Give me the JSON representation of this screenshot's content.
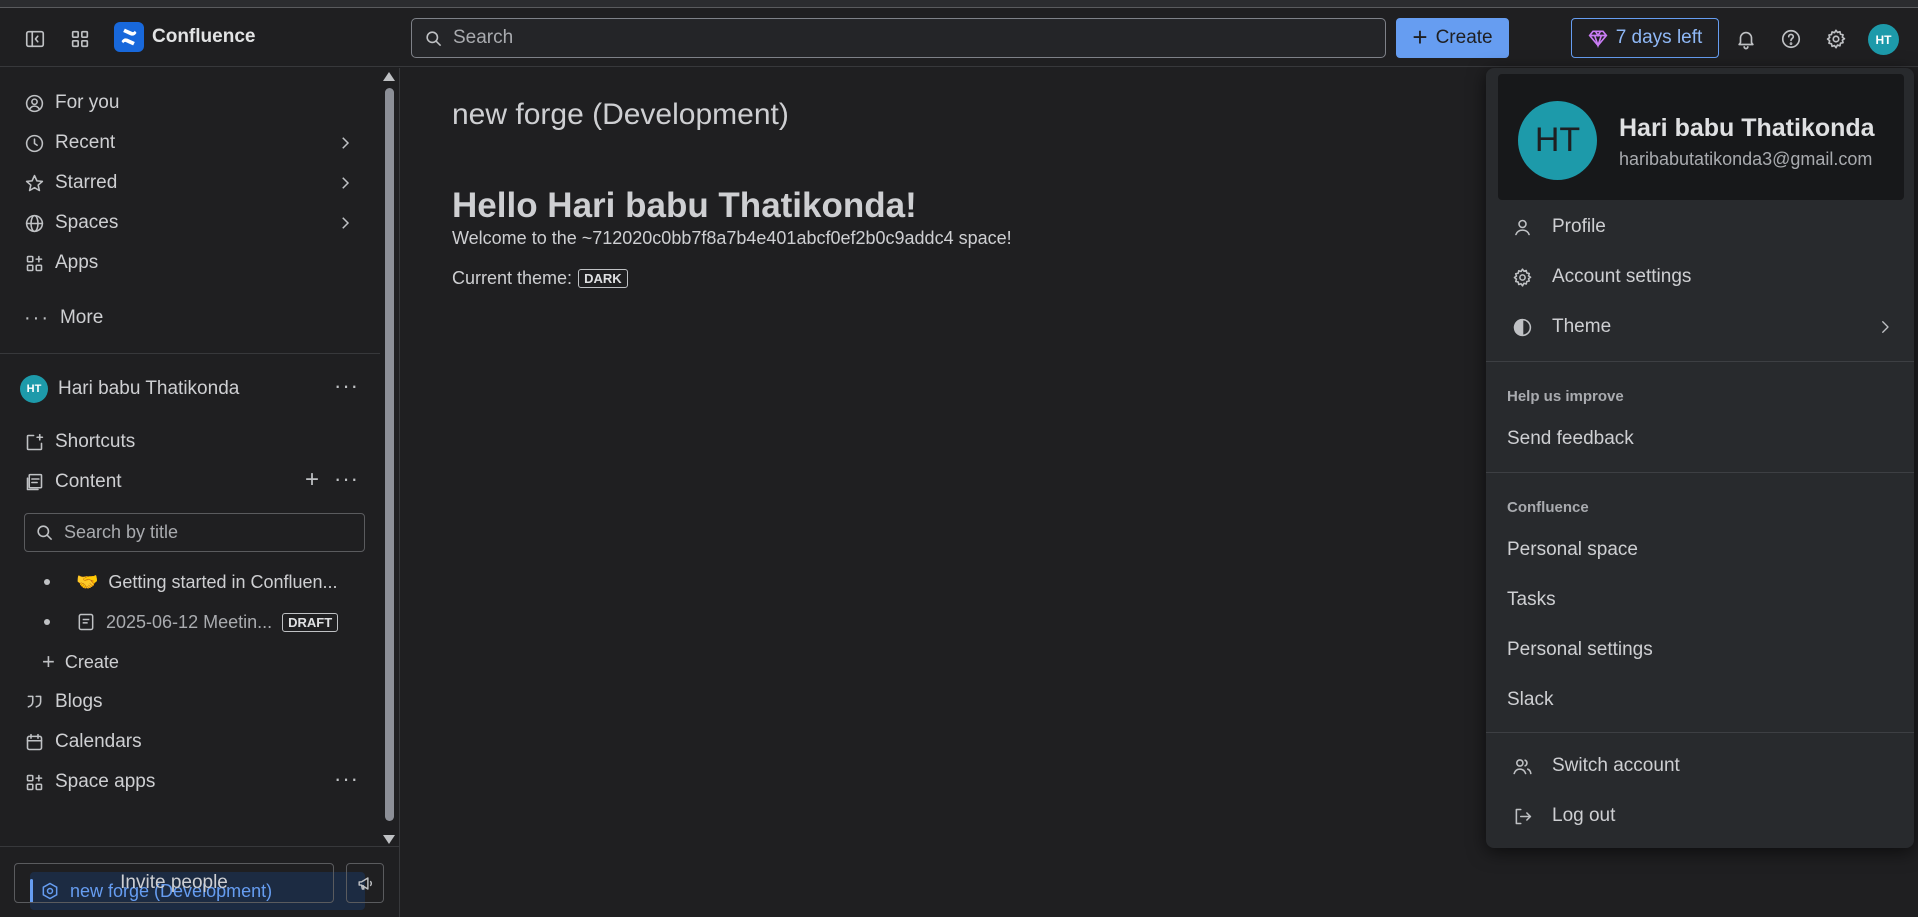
{
  "topbar": {
    "brand": "Confluence",
    "search_placeholder": "Search",
    "create_label": "Create",
    "trial_label": "7 days left",
    "avatar_initials": "HT"
  },
  "sidebar": {
    "nav": {
      "for_you": "For you",
      "recent": "Recent",
      "starred": "Starred",
      "spaces": "Spaces",
      "apps": "Apps",
      "more": "More"
    },
    "space": {
      "initials": "HT",
      "name": "Hari babu Thatikonda",
      "shortcuts": "Shortcuts",
      "content": "Content",
      "search_placeholder": "Search by title",
      "pages": [
        {
          "emoji": "🤝",
          "title": "Getting started in Confluen..."
        },
        {
          "title": "2025-06-12 Meetin...",
          "badge": "DRAFT"
        }
      ],
      "create": "Create",
      "blogs": "Blogs",
      "calendars": "Calendars",
      "space_apps": "Space apps",
      "active_app": "new forge (Development)"
    },
    "invite_label": "Invite people"
  },
  "main": {
    "page_title": "new forge (Development)",
    "greeting": "Hello Hari babu Thatikonda!",
    "welcome": "Welcome to the ~712020c0bb7f8a7b4e401abcf0ef2b0c9addc4 space!",
    "theme_prefix": "Current theme:",
    "theme_value": "DARK"
  },
  "account_menu": {
    "initials": "HT",
    "name": "Hari babu Thatikonda",
    "email": "haribabutatikonda3@gmail.com",
    "profile": "Profile",
    "account_settings": "Account settings",
    "theme": "Theme",
    "help_section": "Help us improve",
    "send_feedback": "Send feedback",
    "confluence_section": "Confluence",
    "personal_space": "Personal space",
    "tasks": "Tasks",
    "personal_settings": "Personal settings",
    "slack": "Slack",
    "switch_account": "Switch account",
    "log_out": "Log out"
  },
  "colors": {
    "accent": "#669df1",
    "avatar": "#1d9aaa",
    "background": "#1f1f21",
    "menu_background": "#282a2d"
  }
}
